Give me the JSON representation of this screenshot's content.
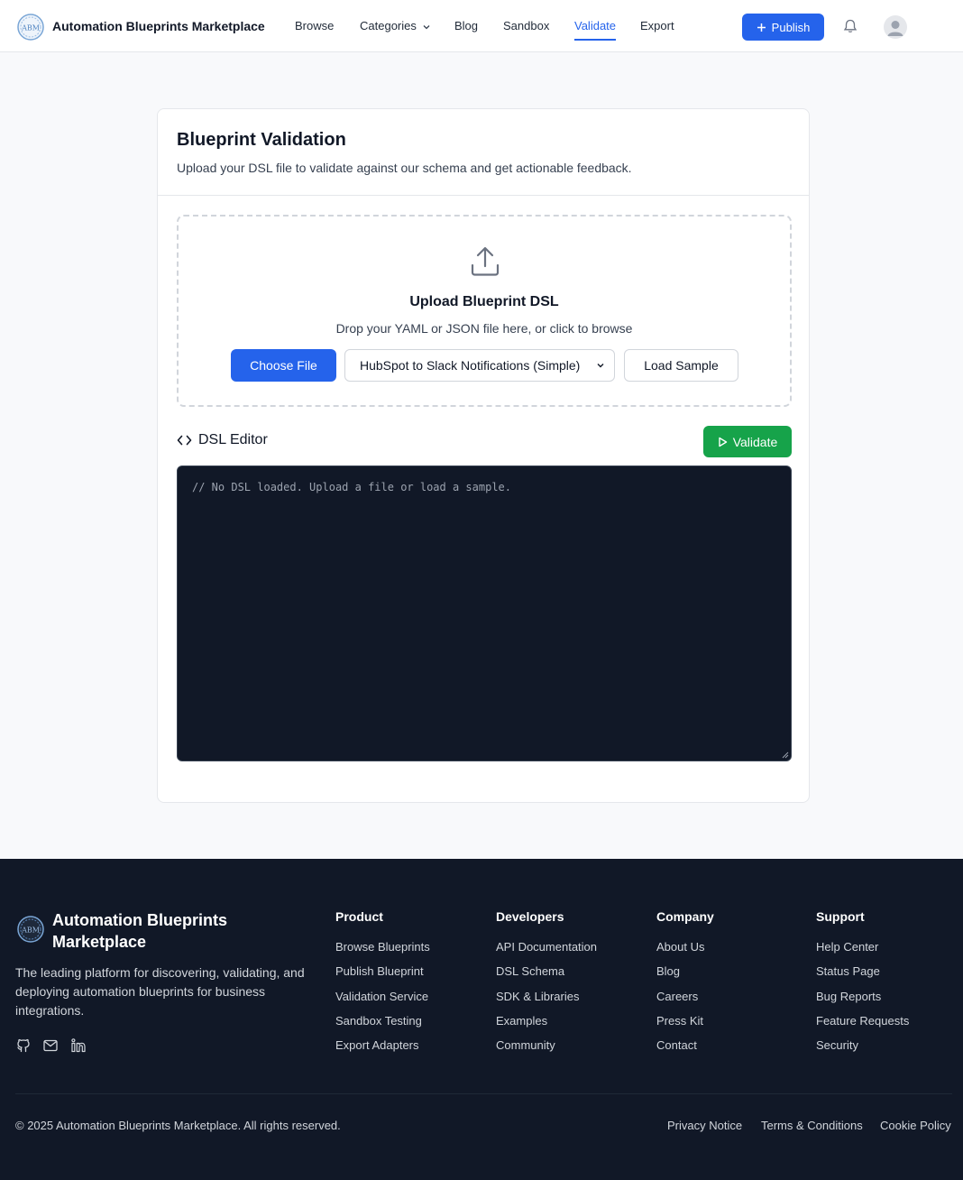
{
  "header": {
    "logo_text": "ABM",
    "brand": "Automation Blueprints Marketplace",
    "nav": {
      "browse": "Browse",
      "categories": "Categories",
      "blog": "Blog",
      "sandbox": "Sandbox",
      "validate": "Validate",
      "export": "Export"
    },
    "active_nav": "Validate",
    "publish_label": "Publish"
  },
  "validation": {
    "title": "Blueprint Validation",
    "subtitle": "Upload your DSL file to validate against our schema and get actionable feedback.",
    "dropzone": {
      "title": "Upload Blueprint DSL",
      "subtitle": "Drop your YAML or JSON file here, or click to browse",
      "choose_file_label": "Choose File",
      "sample_selected": "HubSpot to Slack Notifications (Simple)",
      "load_sample_label": "Load Sample"
    },
    "editor": {
      "label": "DSL Editor",
      "validate_label": "Validate",
      "placeholder": "// No DSL loaded. Upload a file or load a sample."
    }
  },
  "footer": {
    "logo_text": "ABM",
    "brand": "Automation Blueprints Marketplace",
    "description": "The leading platform for discovering, validating, and deploying automation blueprints for business integrations.",
    "columns": [
      {
        "title": "Product",
        "links": [
          "Browse Blueprints",
          "Publish Blueprint",
          "Validation Service",
          "Sandbox Testing",
          "Export Adapters"
        ]
      },
      {
        "title": "Developers",
        "links": [
          "API Documentation",
          "DSL Schema",
          "SDK & Libraries",
          "Examples",
          "Community"
        ]
      },
      {
        "title": "Company",
        "links": [
          "About Us",
          "Blog",
          "Careers",
          "Press Kit",
          "Contact"
        ]
      },
      {
        "title": "Support",
        "links": [
          "Help Center",
          "Status Page",
          "Bug Reports",
          "Feature Requests",
          "Security"
        ]
      }
    ],
    "copyright": "© 2025 Automation Blueprints Marketplace. All rights reserved.",
    "legal": {
      "privacy": "Privacy Notice",
      "terms": "Terms & Conditions",
      "cookies": "Cookie Policy"
    }
  },
  "colors": {
    "primary": "#2563eb",
    "success": "#16a34a",
    "editor_bg": "#111827",
    "footer_bg": "#111827"
  },
  "icons": [
    "abm-logo-icon",
    "chevron-down-icon",
    "plus-icon",
    "bell-icon",
    "user-avatar-icon",
    "upload-icon",
    "code-icon",
    "play-icon",
    "github-icon",
    "mail-icon",
    "linkedin-icon"
  ]
}
